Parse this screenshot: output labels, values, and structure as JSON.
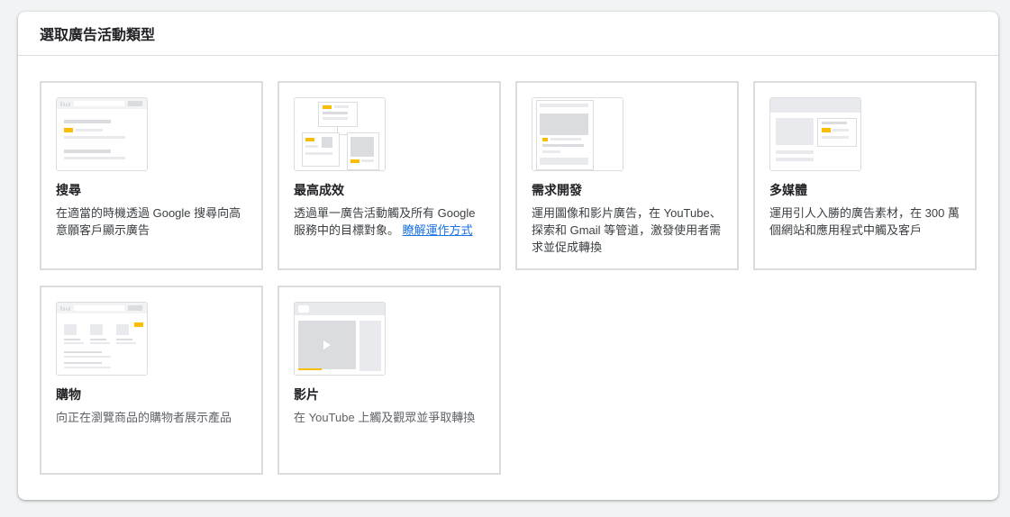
{
  "panel": {
    "title": "選取廣告活動類型"
  },
  "cards": [
    {
      "title": "搜尋",
      "desc": "在適當的時機透過 Google 搜尋向高意願客戶顯示廣告"
    },
    {
      "title": "最高成效",
      "desc": "透過單一廣告活動觸及所有 Google 服務中的目標對象。",
      "link": "瞭解運作方式"
    },
    {
      "title": "需求開發",
      "desc": "運用圖像和影片廣告，在 YouTube、探索和 Gmail 等管道，激發使用者需求並促成轉換"
    },
    {
      "title": "多媒體",
      "desc": "運用引人入勝的廣告素材，在 300 萬個網站和應用程式中觸及客戶"
    },
    {
      "title": "購物",
      "desc": "向正在瀏覽商品的購物者展示產品"
    },
    {
      "title": "影片",
      "desc": "在 YouTube 上觸及觀眾並爭取轉換"
    }
  ],
  "colors": {
    "accent": "#fbbc04",
    "link": "#1a73e8",
    "border": "#dadce0"
  },
  "icons": [
    "search-illustration",
    "performance-max-illustration",
    "demand-gen-illustration",
    "display-illustration",
    "shopping-illustration",
    "video-illustration"
  ]
}
